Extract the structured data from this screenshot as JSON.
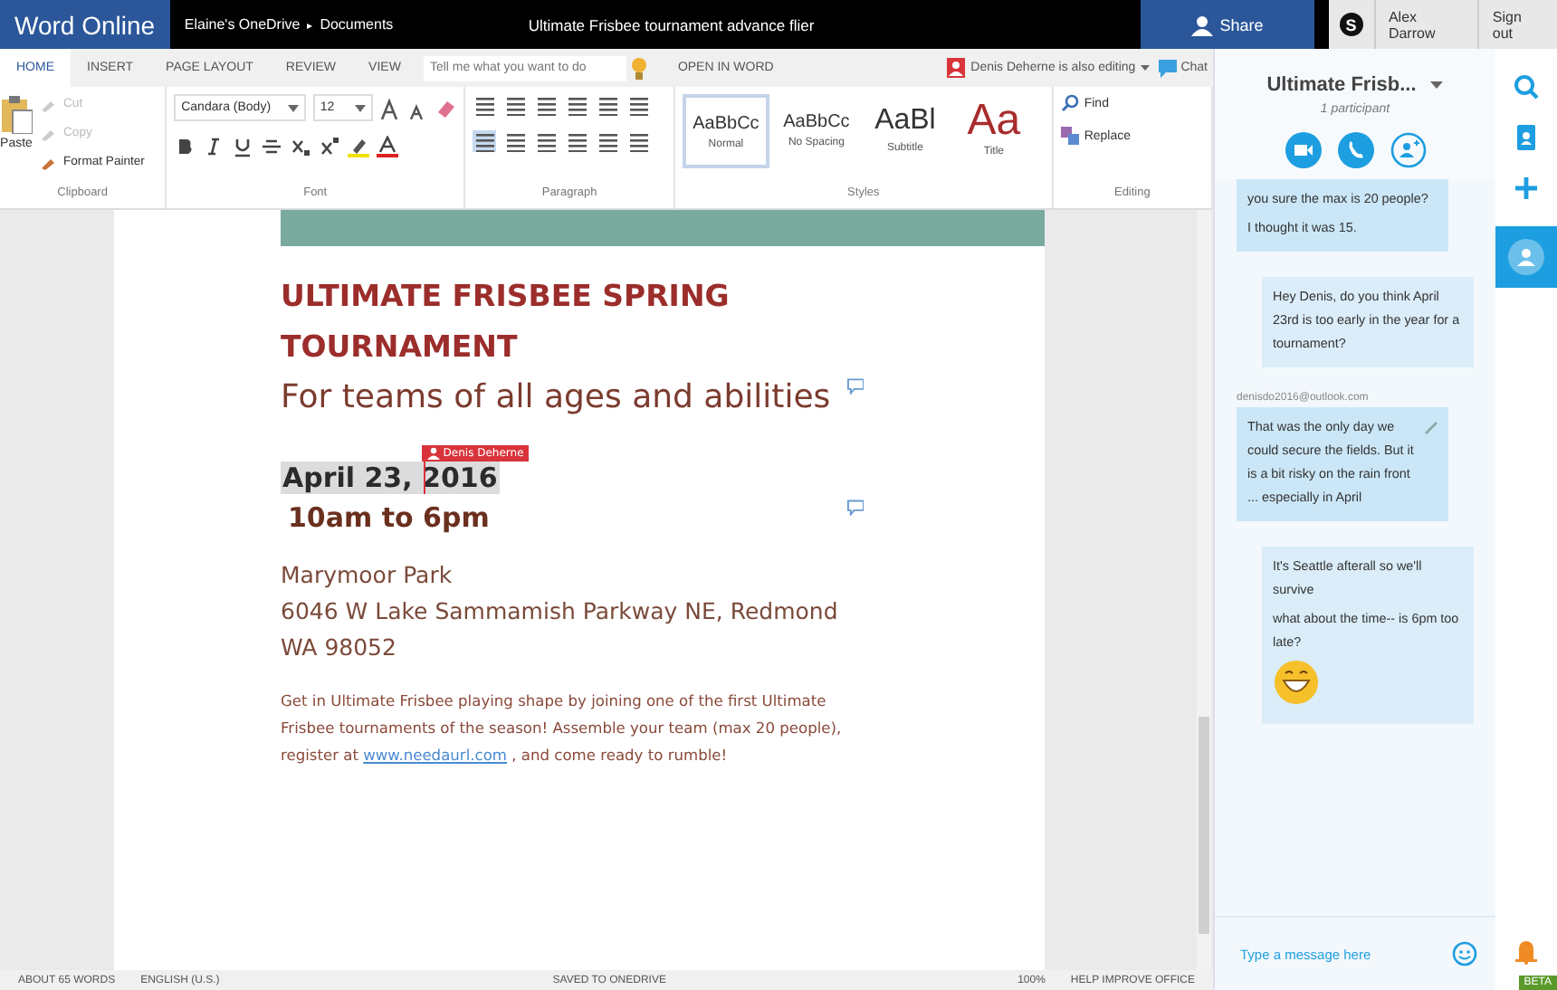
{
  "app_bar": {
    "app_name": "Word Online",
    "breadcrumb": [
      "Elaine's OneDrive",
      "Documents"
    ],
    "separator": "▸",
    "doc_title": "Ultimate Frisbee tournament advance flier",
    "share": "Share",
    "skype_logo": "S",
    "user_name": "Alex Darrow",
    "sign_out": "Sign out"
  },
  "ribbon": {
    "tabs": [
      {
        "label": "HOME",
        "selected": true
      },
      {
        "label": "INSERT",
        "selected": false
      },
      {
        "label": "PAGE LAYOUT",
        "selected": false
      },
      {
        "label": "REVIEW",
        "selected": false
      },
      {
        "label": "VIEW",
        "selected": false
      }
    ],
    "tell_me": {
      "placeholder": "Tell me what you want to do"
    },
    "open_in_word": "OPEN IN WORD",
    "coauthor": "Denis Deherne is also editing",
    "chat": "Chat",
    "clipboard": {
      "paste": "Paste",
      "items": [
        {
          "label": "Cut",
          "disabled": true
        },
        {
          "label": "Copy",
          "disabled": true
        },
        {
          "label": "Format Painter",
          "disabled": false
        }
      ],
      "group": "Clipboard"
    },
    "font": {
      "name": "Candara (Body)",
      "size": "12",
      "group": "Font"
    },
    "paragraph": {
      "group": "Paragraph"
    },
    "styles": {
      "items": [
        {
          "sample": "AaBbCc",
          "name": "Normal",
          "kind": "normal",
          "selected": true
        },
        {
          "sample": "AaBbCc",
          "name": "No Spacing",
          "kind": "normal",
          "selected": false
        },
        {
          "sample": "AaBl",
          "name": "Subtitle",
          "kind": "subtitle",
          "selected": false
        },
        {
          "sample": "Aa",
          "name": "Title",
          "kind": "title",
          "selected": false
        }
      ],
      "group": "Styles"
    },
    "editing": {
      "find": "Find",
      "replace": "Replace",
      "group": "Editing"
    }
  },
  "document": {
    "heading": "ULTIMATE FRISBEE SPRING TOURNAMENT",
    "subtitle": "For teams of all ages and abilities",
    "date": "April 23, 2016",
    "cursor_flag": "Denis Deherne",
    "time": "10am to 6pm",
    "address": [
      "Marymoor Park",
      "6046 W Lake Sammamish Parkway NE, Redmond",
      "WA 98052"
    ],
    "body": "Get in Ultimate Frisbee playing shape by joining one of the first Ultimate Frisbee tournaments of the season!   Assemble your team (max 20 people), register at",
    "link": "www.needaurl.com",
    "body_end": " , and come ready to rumble!"
  },
  "chat": {
    "title": "Ultimate Frisb...",
    "participants": "1 participant",
    "messages": [
      {
        "kind": "received",
        "lines": [
          "you sure the max is 20 people?",
          "I thought it was 15."
        ],
        "emoji": false,
        "editing": false
      },
      {
        "kind": "sent",
        "lines": [
          "Hey Denis, do you think April 23rd is too early in the year for a tournament?"
        ],
        "emoji": false,
        "editing": false
      },
      {
        "kind": "received",
        "sender": "denisdo2016@outlook.com",
        "lines": [
          "That was the only day we could secure the fields.  But it is a bit risky on the rain front ... especially in April"
        ],
        "emoji": false,
        "editing": true
      },
      {
        "kind": "sent",
        "lines": [
          "It's Seattle afterall so we'll survive",
          "what about the time-- is 6pm too late?"
        ],
        "emoji": true,
        "editing": false
      }
    ],
    "input": {
      "placeholder": "Type a message here"
    }
  },
  "status_bar": [
    "ABOUT 65 WORDS",
    "ENGLISH (U.S.)",
    "SAVED TO ONEDRIVE",
    "100%",
    "HELP IMPROVE OFFICE"
  ],
  "beta": "BETA"
}
